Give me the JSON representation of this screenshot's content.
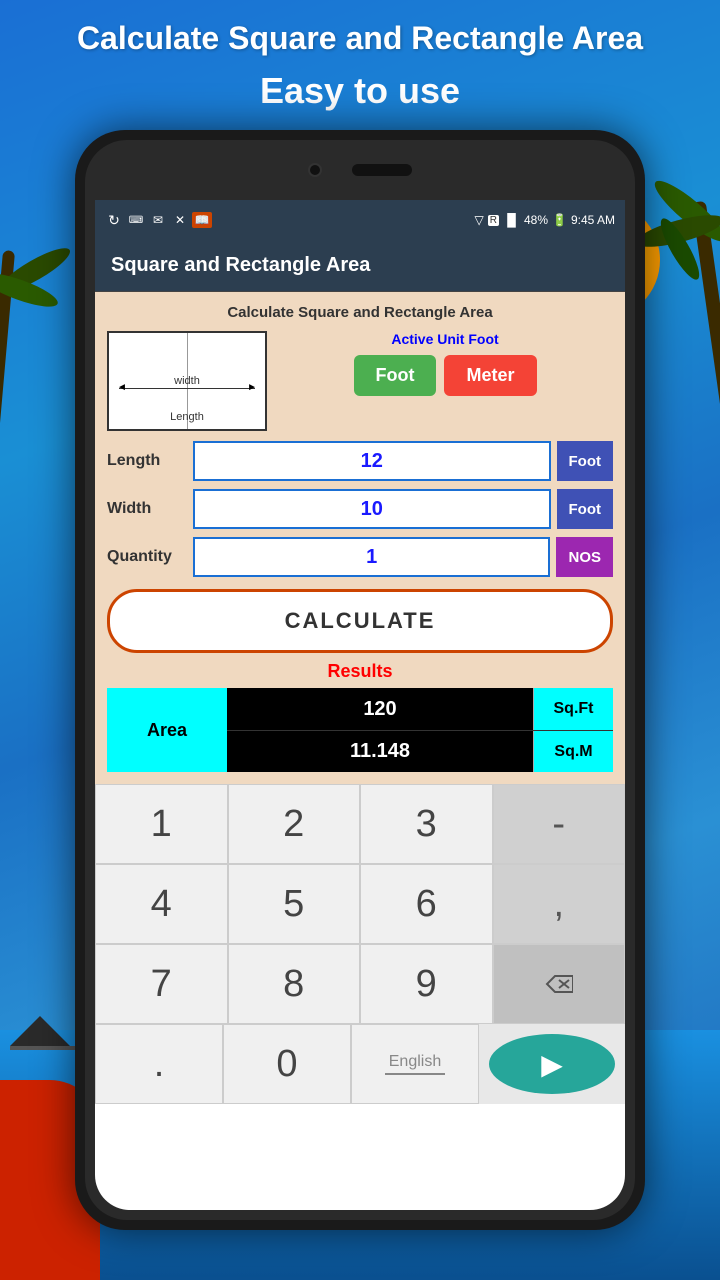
{
  "page": {
    "bg_title": "Calculate Square and Rectangle Area",
    "bg_subtitle": "Easy to use"
  },
  "status_bar": {
    "battery": "48%",
    "time": "9:45 AM"
  },
  "app_bar": {
    "title": "Square and Rectangle Area"
  },
  "calc_card": {
    "header": "Calculate Square and Rectangle Area",
    "active_unit_label": "Active Unit Foot",
    "btn_foot": "Foot",
    "btn_meter": "Meter",
    "length_label": "Length",
    "length_value": "12",
    "length_unit": "Foot",
    "width_label": "Width",
    "width_value": "10",
    "width_unit": "Foot",
    "quantity_label": "Quantity",
    "quantity_value": "1",
    "quantity_unit": "NOS",
    "calculate_btn": "CALCULATE",
    "results_label": "Results",
    "area_label": "Area",
    "area_sqft": "120",
    "area_sqft_unit": "Sq.Ft",
    "area_sqm": "11.148",
    "area_sqm_unit": "Sq.M"
  },
  "numpad": {
    "keys": [
      "1",
      "2",
      "3",
      "-",
      "4",
      "5",
      "6",
      ",",
      "7",
      "8",
      "9",
      "⌫",
      ".",
      "0",
      "English",
      "▶"
    ],
    "dot": ".",
    "zero": "0",
    "english": "English",
    "next": "▶"
  }
}
